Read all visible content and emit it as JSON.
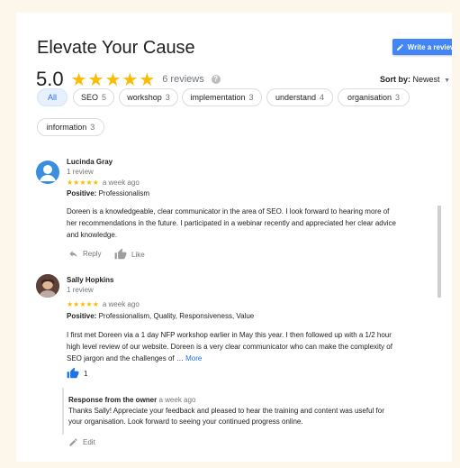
{
  "header": {
    "title": "Elevate Your Cause",
    "write_review_label": "Write a review"
  },
  "summary": {
    "rating": "5.0",
    "stars": "★★★★★",
    "review_count": "6 reviews",
    "sort_label": "Sort by:",
    "sort_value": "Newest"
  },
  "filters": [
    {
      "label": "All",
      "count": ""
    },
    {
      "label": "SEO",
      "count": "5"
    },
    {
      "label": "workshop",
      "count": "3"
    },
    {
      "label": "implementation",
      "count": "3"
    },
    {
      "label": "understand",
      "count": "4"
    },
    {
      "label": "organisation",
      "count": "3"
    },
    {
      "label": "information",
      "count": "3"
    }
  ],
  "reviews": [
    {
      "name": "Lucinda Gray",
      "sub": "1 review",
      "stars": "★★★★★",
      "time": "a week ago",
      "positive_label": "Positive:",
      "positive_value": "Professionalism",
      "text_lines": [
        "Doreen is a knowledgeable, clear communicator in the area of SEO. I look forward to hearing more of",
        "her recommendations in the future. I participated in a webinar recently and appreciated her clear advice",
        "and knowledge."
      ],
      "reply_label": "Reply",
      "like_label": "Like"
    },
    {
      "name": "Sally Hopkins",
      "sub": "1 review",
      "stars": "★★★★★",
      "time": "a week ago",
      "positive_label": "Positive:",
      "positive_value": "Professionalism, Quality, Responsiveness, Value",
      "text_lines": [
        "I first met Doreen via a 1 day NFP workshop earlier in May this year.  I then followed up with a 1/2 hour",
        "high level review of our website.  Doreen is a very clear communicator who can make the complexity of",
        "SEO jargon and the challenges of … "
      ],
      "more_label": "More",
      "like_count": "1",
      "owner_label": "Response from the owner",
      "owner_time": "a week ago",
      "owner_lines": [
        "Thanks Sally! Appreciate your feedback and pleased to hear the training and content was useful for",
        "your organisation. Look forward to seeing your continued progress online."
      ],
      "edit_label": "Edit"
    }
  ],
  "colors": {
    "accent": "#4285f4",
    "star": "#fbbc05",
    "background": "#fdf6ea"
  }
}
